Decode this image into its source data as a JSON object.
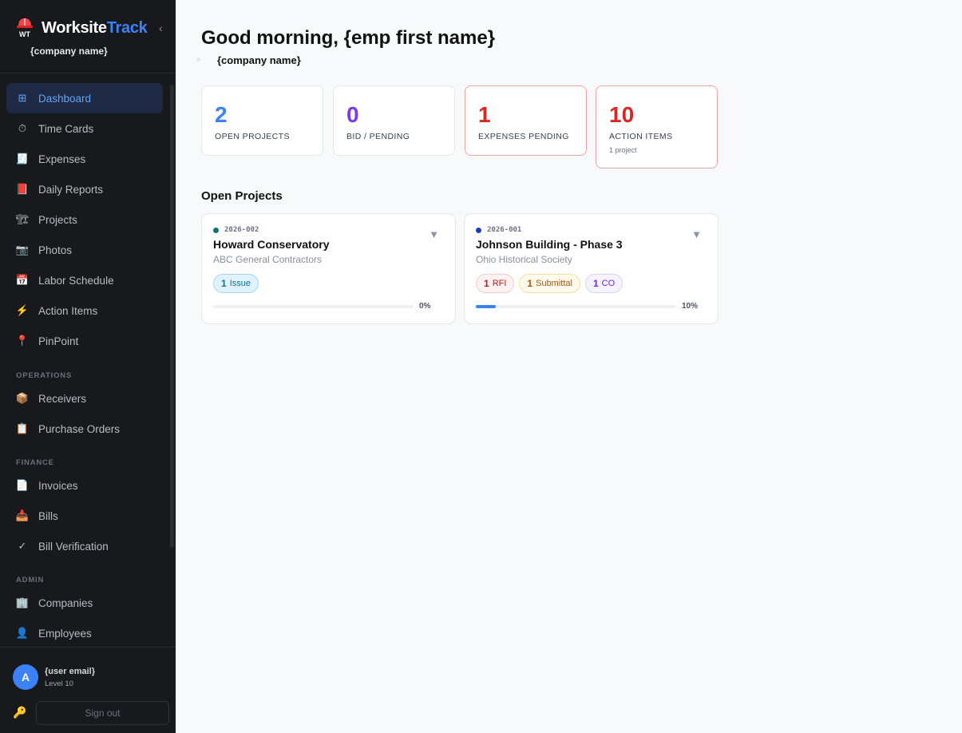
{
  "brand": {
    "name_part1": "Worksite",
    "name_part2": "Track",
    "company": "{company name}",
    "collapse_glyph": "‹",
    "logo_text": "WT"
  },
  "nav": {
    "items": [
      {
        "label": "Dashboard",
        "icon": "⊞",
        "active": true
      },
      {
        "label": "Time Cards",
        "icon": "⏱"
      },
      {
        "label": "Expenses",
        "icon": "🧾"
      },
      {
        "label": "Daily Reports",
        "icon": "📕"
      },
      {
        "label": "Projects",
        "icon": "🏗"
      },
      {
        "label": "Photos",
        "icon": "📷"
      },
      {
        "label": "Labor Schedule",
        "icon": "📅"
      },
      {
        "label": "Action Items",
        "icon": "⚡"
      },
      {
        "label": "PinPoint",
        "icon": "📍"
      }
    ],
    "operations_label": "OPERATIONS",
    "operations": [
      {
        "label": "Receivers",
        "icon": "📦"
      },
      {
        "label": "Purchase Orders",
        "icon": "📋"
      }
    ],
    "finance_label": "FINANCE",
    "finance": [
      {
        "label": "Invoices",
        "icon": "📄"
      },
      {
        "label": "Bills",
        "icon": "📥"
      },
      {
        "label": "Bill Verification",
        "icon": "✓"
      }
    ],
    "admin_label": "ADMIN",
    "admin": [
      {
        "label": "Companies",
        "icon": "🏢"
      },
      {
        "label": "Employees",
        "icon": "👤"
      }
    ]
  },
  "user": {
    "avatar_letter": "A",
    "email": "{user email}",
    "level": "Level 10",
    "key_icon": "🔑",
    "signout_label": "Sign out"
  },
  "main": {
    "greeting": "Good morning, {emp first name}",
    "company": "{company name}",
    "stats": [
      {
        "value": "2",
        "label": "OPEN PROJECTS",
        "color": "#3b82f6"
      },
      {
        "value": "0",
        "label": "BID / PENDING",
        "color": "#7c3aed"
      },
      {
        "value": "1",
        "label": "EXPENSES PENDING",
        "color": "#dc2626"
      },
      {
        "value": "10",
        "label": "ACTION ITEMS",
        "sub": "1 project",
        "color": "#dc2626"
      }
    ],
    "open_projects_title": "Open Projects",
    "projects": [
      {
        "code": "2026-002",
        "name": "Howard Conservatory",
        "client": "ABC General Contractors",
        "dot_color": "#0f766e",
        "tags": [
          {
            "count": "1",
            "label": "Issue"
          }
        ],
        "progress_label": "0%",
        "progress": 0
      },
      {
        "code": "2026-001",
        "name": "Johnson Building - Phase 3",
        "client": "Ohio Historical Society",
        "dot_color": "#1e40af",
        "tags": [
          {
            "count": "1",
            "label": "RFI"
          },
          {
            "count": "1",
            "label": "Submittal"
          },
          {
            "count": "1",
            "label": "CO"
          }
        ],
        "progress_label": "10%",
        "progress": 0.1
      }
    ],
    "chevron": "▼"
  }
}
